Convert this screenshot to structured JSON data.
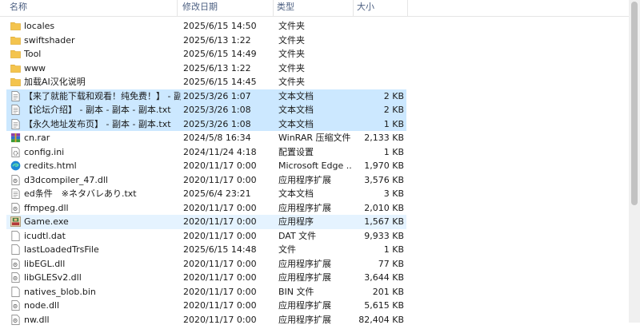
{
  "columns": {
    "name": "名称",
    "date": "修改日期",
    "type": "类型",
    "size": "大小"
  },
  "files": [
    {
      "name": "locales",
      "date": "2025/6/15 14:50",
      "type": "文件夹",
      "size": "",
      "icon": "folder-icon"
    },
    {
      "name": "swiftshader",
      "date": "2025/6/13 1:22",
      "type": "文件夹",
      "size": "",
      "icon": "folder-icon"
    },
    {
      "name": "Tool",
      "date": "2025/6/15 14:49",
      "type": "文件夹",
      "size": "",
      "icon": "folder-icon"
    },
    {
      "name": "www",
      "date": "2025/6/13 1:22",
      "type": "文件夹",
      "size": "",
      "icon": "folder-icon"
    },
    {
      "name": "加载AI汉化说明",
      "date": "2025/6/15 14:45",
      "type": "文件夹",
      "size": "",
      "icon": "folder-icon"
    },
    {
      "name": "【来了就能下载和观看！纯免费！】 - 副...",
      "date": "2025/3/26 1:07",
      "type": "文本文档",
      "size": "2 KB",
      "icon": "text-file-icon",
      "state": "selected"
    },
    {
      "name": "【论坛介绍】 - 副本 - 副本 - 副本.txt",
      "date": "2025/3/26 1:08",
      "type": "文本文档",
      "size": "2 KB",
      "icon": "text-file-icon",
      "state": "selected"
    },
    {
      "name": "【永久地址发布页】 - 副本 - 副本.txt",
      "date": "2025/3/26 1:08",
      "type": "文本文档",
      "size": "1 KB",
      "icon": "text-file-icon",
      "state": "selected"
    },
    {
      "name": "cn.rar",
      "date": "2024/5/8 16:34",
      "type": "WinRAR 压缩文件",
      "size": "2,133 KB",
      "icon": "winrar-archive-icon"
    },
    {
      "name": "config.ini",
      "date": "2024/11/24 4:18",
      "type": "配置设置",
      "size": "1 KB",
      "icon": "settings-file-icon"
    },
    {
      "name": "credits.html",
      "date": "2020/11/17 0:00",
      "type": "Microsoft Edge ...",
      "size": "1,970 KB",
      "icon": "edge-browser-icon"
    },
    {
      "name": "d3dcompiler_47.dll",
      "date": "2020/11/17 0:00",
      "type": "应用程序扩展",
      "size": "3,576 KB",
      "icon": "dll-file-icon"
    },
    {
      "name": "ed条件　※ネタバレあり.txt",
      "date": "2025/6/4 23:21",
      "type": "文本文档",
      "size": "3 KB",
      "icon": "text-file-icon"
    },
    {
      "name": "ffmpeg.dll",
      "date": "2020/11/17 0:00",
      "type": "应用程序扩展",
      "size": "2,010 KB",
      "icon": "dll-file-icon"
    },
    {
      "name": "Game.exe",
      "date": "2020/11/17 0:00",
      "type": "应用程序",
      "size": "1,567 KB",
      "icon": "game-exe-icon",
      "state": "hover"
    },
    {
      "name": "icudtl.dat",
      "date": "2020/11/17 0:00",
      "type": "DAT 文件",
      "size": "9,933 KB",
      "icon": "blank-file-icon"
    },
    {
      "name": "lastLoadedTrsFile",
      "date": "2025/6/15 14:48",
      "type": "文件",
      "size": "1 KB",
      "icon": "blank-file-icon"
    },
    {
      "name": "libEGL.dll",
      "date": "2020/11/17 0:00",
      "type": "应用程序扩展",
      "size": "77 KB",
      "icon": "dll-file-icon"
    },
    {
      "name": "libGLESv2.dll",
      "date": "2020/11/17 0:00",
      "type": "应用程序扩展",
      "size": "3,644 KB",
      "icon": "dll-file-icon"
    },
    {
      "name": "natives_blob.bin",
      "date": "2020/11/17 0:00",
      "type": "BIN 文件",
      "size": "201 KB",
      "icon": "blank-file-icon"
    },
    {
      "name": "node.dll",
      "date": "2020/11/17 0:00",
      "type": "应用程序扩展",
      "size": "5,615 KB",
      "icon": "dll-file-icon"
    },
    {
      "name": "nw.dll",
      "date": "2020/11/17 0:00",
      "type": "应用程序扩展",
      "size": "82,404 KB",
      "icon": "dll-file-icon"
    }
  ],
  "colors": {
    "selection": "#cce8ff",
    "hover": "#e5f3ff",
    "folder": "#f4c44e",
    "header_text": "#4d6082"
  }
}
